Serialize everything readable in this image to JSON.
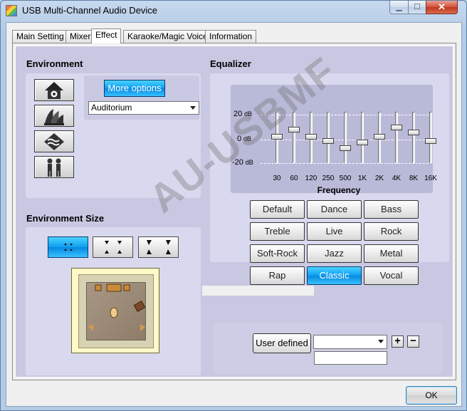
{
  "window": {
    "title": "USB Multi-Channel Audio Device"
  },
  "caption_buttons": {
    "minimize": "▁",
    "maximize": "☐",
    "close": "✕"
  },
  "tabs": [
    {
      "label": "Main Setting",
      "active": false
    },
    {
      "label": "Mixer",
      "active": false
    },
    {
      "label": "Effect",
      "active": true
    },
    {
      "label": "Karaoke/Magic Voice",
      "active": false
    },
    {
      "label": "Information",
      "active": false
    }
  ],
  "environment": {
    "title": "Environment",
    "more_options_label": "More options",
    "selected_environment": "Auditorium",
    "buttons": [
      "home-icon",
      "opera-house-icon",
      "underwater-icon",
      "people-icon"
    ]
  },
  "environment_size": {
    "title": "Environment Size",
    "selected_index": 0
  },
  "equalizer": {
    "title": "Equalizer",
    "db_top": "20",
    "db_mid": "0",
    "db_bottom": "-20",
    "db_unit": "dB",
    "axis_label": "Frequency",
    "bands": [
      {
        "label": "30",
        "value": 0
      },
      {
        "label": "60",
        "value": 6
      },
      {
        "label": "120",
        "value": 0
      },
      {
        "label": "250",
        "value": -4
      },
      {
        "label": "500",
        "value": -10
      },
      {
        "label": "1K",
        "value": -5
      },
      {
        "label": "2K",
        "value": 0
      },
      {
        "label": "4K",
        "value": 8
      },
      {
        "label": "8K",
        "value": 4
      },
      {
        "label": "16K",
        "value": -4
      }
    ],
    "presets": [
      {
        "label": "Default",
        "active": false
      },
      {
        "label": "Dance",
        "active": false
      },
      {
        "label": "Bass",
        "active": false
      },
      {
        "label": "Treble",
        "active": false
      },
      {
        "label": "Live",
        "active": false
      },
      {
        "label": "Rock",
        "active": false
      },
      {
        "label": "Soft-Rock",
        "active": false
      },
      {
        "label": "Jazz",
        "active": false
      },
      {
        "label": "Metal",
        "active": false
      },
      {
        "label": "Rap",
        "active": false
      },
      {
        "label": "Classic",
        "active": true
      },
      {
        "label": "Vocal",
        "active": false
      }
    ],
    "user_defined_label": "User defined",
    "user_defined_selected": "",
    "user_defined_name": "",
    "plus_label": "+",
    "minus_label": "−"
  },
  "footer": {
    "ok_label": "OK"
  },
  "watermark": "AU-USBMF"
}
